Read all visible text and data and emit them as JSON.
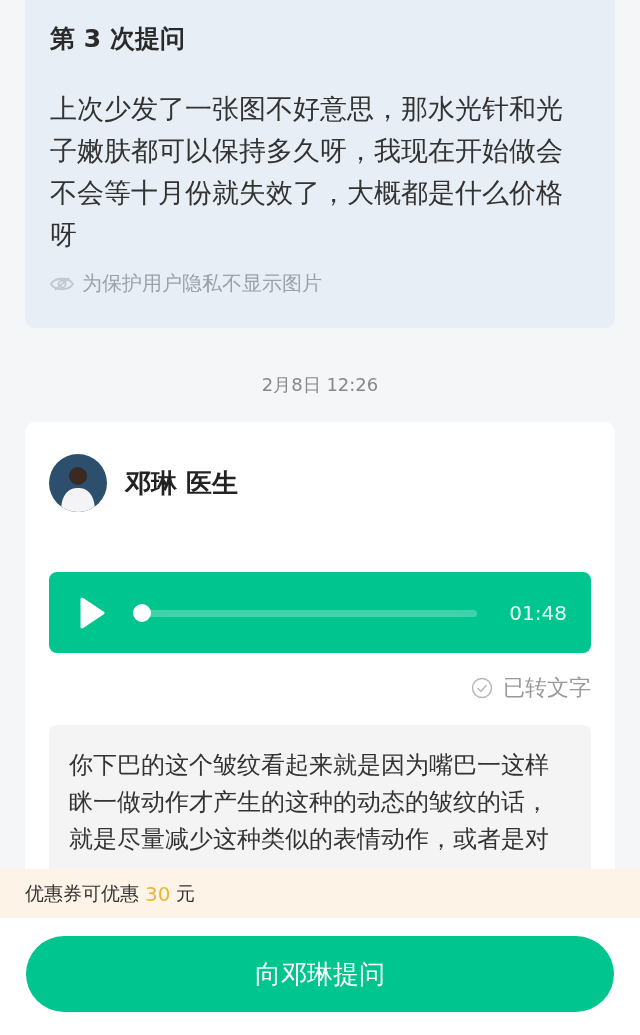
{
  "question": {
    "title": "第 3 次提问",
    "body": "上次少发了一张图不好意思，那水光针和光子嫩肤都可以保持多久呀，我现在开始做会不会等十月份就失效了，大概都是什么价格呀",
    "privacy_note": "为保护用户隐私不显示图片"
  },
  "timestamp": "2月8日 12:26",
  "answer": {
    "doctor_name": "邓琳 医生",
    "voice": {
      "duration": "01:48",
      "level": 0.0
    },
    "transcribed_label": "已转文字",
    "transcript": "你下巴的这个皱纹看起来就是因为嘴巴一这样眯一做动作才产生的这种的动态的皱纹的话，就是尽量减少这种类似的表情动作，或者是对"
  },
  "coupon": {
    "prefix": "优惠券可优惠",
    "amount": "30",
    "suffix": "元"
  },
  "ask_button": "向邓琳提问"
}
